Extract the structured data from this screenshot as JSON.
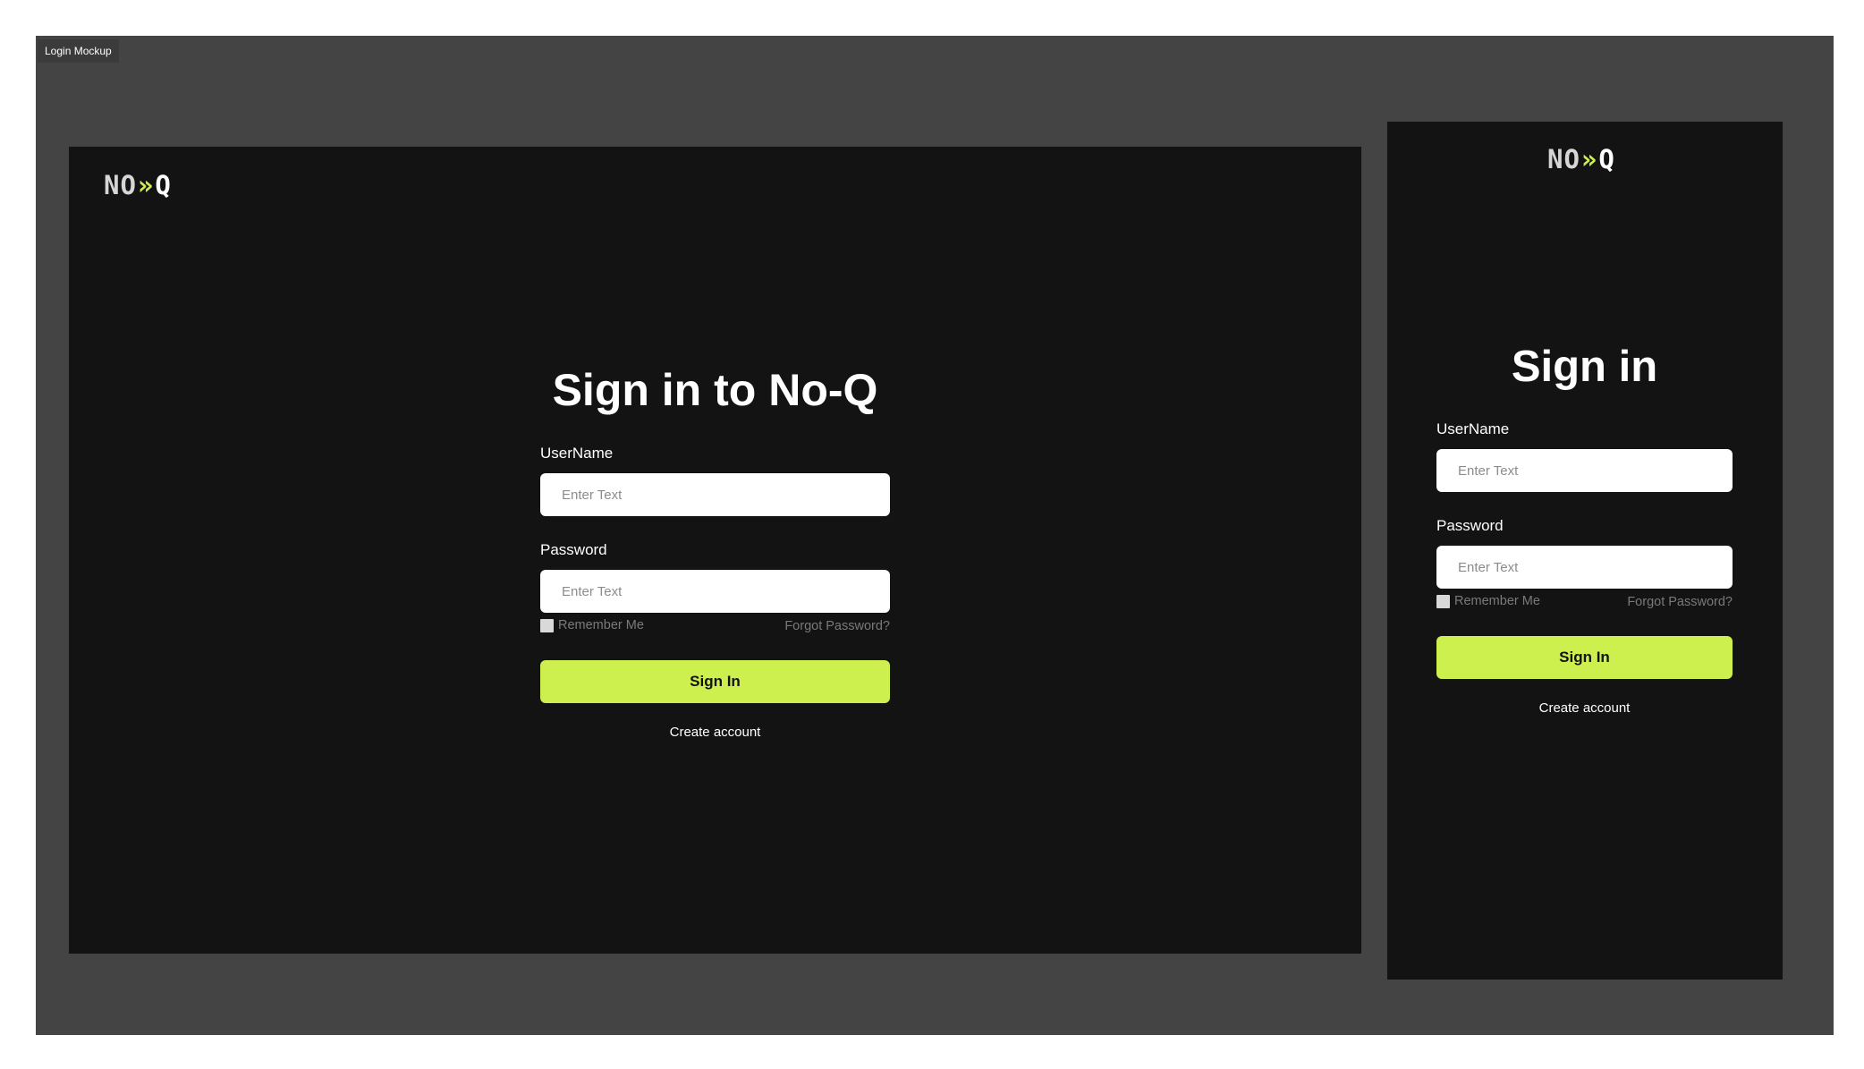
{
  "frame_label": "Login Mockup",
  "brand": {
    "logo_no": "NO",
    "logo_arrows": "»",
    "logo_q": "Q",
    "accent": "#cdf04f"
  },
  "desktop": {
    "title": "Sign in to No-Q",
    "username_label": "UserName",
    "username_placeholder": "Enter Text",
    "password_label": "Password",
    "password_placeholder": "Enter Text",
    "remember_label": "Remember Me",
    "forgot_label": "Forgot Password?",
    "signin_label": "Sign In",
    "create_label": "Create account"
  },
  "mobile": {
    "title": "Sign in",
    "username_label": "UserName",
    "username_placeholder": "Enter Text",
    "password_label": "Password",
    "password_placeholder": "Enter Text",
    "remember_label": "Remember Me",
    "forgot_label": "Forgot Password?",
    "signin_label": "Sign In",
    "create_label": "Create account"
  }
}
